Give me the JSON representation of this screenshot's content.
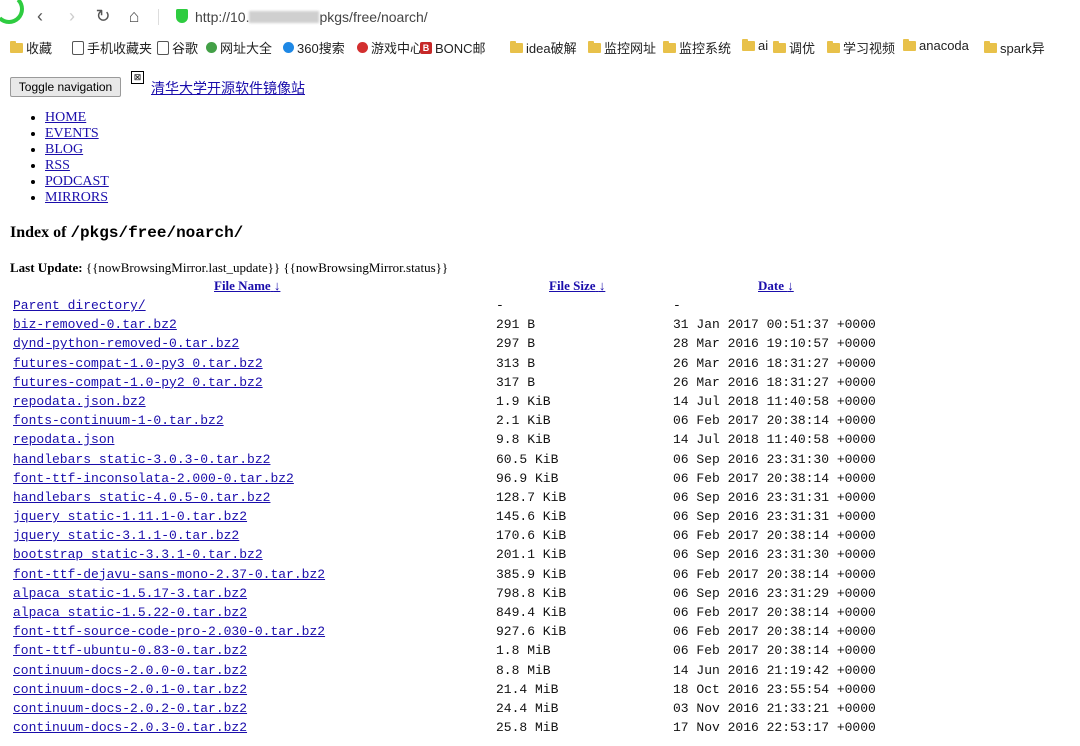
{
  "browser": {
    "url_prefix": "http://10.",
    "url_suffix": "pkgs/free/noarch/",
    "bookmarks": [
      {
        "label": "收藏",
        "icon": "star-icon"
      },
      {
        "label": "手机收藏夹",
        "icon": "phone-icon"
      },
      {
        "label": "谷歌",
        "icon": "page-icon"
      },
      {
        "label": "网址大全",
        "icon": "globe-icon"
      },
      {
        "label": "360搜索",
        "icon": "search-icon"
      },
      {
        "label": "游戏中心",
        "icon": "game-icon"
      },
      {
        "label": "BONC邮",
        "icon": "mail-icon"
      },
      {
        "label": "idea破解",
        "icon": "folder-icon"
      },
      {
        "label": "监控网址",
        "icon": "folder-icon"
      },
      {
        "label": "监控系统",
        "icon": "folder-icon"
      },
      {
        "label": "ai",
        "icon": "folder-icon"
      },
      {
        "label": "调优",
        "icon": "folder-icon"
      },
      {
        "label": "学习视频",
        "icon": "folder-icon"
      },
      {
        "label": "anacoda",
        "icon": "folder-icon"
      },
      {
        "label": "spark异",
        "icon": "folder-icon"
      }
    ]
  },
  "page": {
    "toggle_label": "Toggle navigation",
    "broken_image_glyph": "⊠",
    "site_link": "清华大学开源软件镜像站",
    "menu": [
      "HOME",
      "EVENTS",
      "BLOG",
      "RSS",
      "PODCAST",
      "MIRRORS"
    ],
    "heading_prefix": "Index of ",
    "heading_path": "/pkgs/free/noarch/",
    "last_update_label": "Last Update:",
    "last_update_value": " {{nowBrowsingMirror.last_update}} {{nowBrowsingMirror.status}}"
  },
  "table": {
    "headers": {
      "name": "File Name",
      "size": "File Size",
      "date": "Date",
      "sort_arrow": "↓"
    },
    "rows": [
      {
        "name": "Parent directory/",
        "size": "-",
        "date": "-"
      },
      {
        "name": "biz-removed-0.tar.bz2",
        "size": "291 B",
        "date": "31 Jan 2017 00:51:37 +0000"
      },
      {
        "name": "dynd-python-removed-0.tar.bz2",
        "size": "297 B",
        "date": "28 Mar 2016 19:10:57 +0000"
      },
      {
        "name": "futures-compat-1.0-py3_0.tar.bz2",
        "size": "313 B",
        "date": "26 Mar 2016 18:31:27 +0000"
      },
      {
        "name": "futures-compat-1.0-py2_0.tar.bz2",
        "size": "317 B",
        "date": "26 Mar 2016 18:31:27 +0000"
      },
      {
        "name": "repodata.json.bz2",
        "size": "1.9 KiB",
        "date": "14 Jul 2018 11:40:58 +0000"
      },
      {
        "name": "fonts-continuum-1-0.tar.bz2",
        "size": "2.1 KiB",
        "date": "06 Feb 2017 20:38:14 +0000"
      },
      {
        "name": "repodata.json",
        "size": "9.8 KiB",
        "date": "14 Jul 2018 11:40:58 +0000"
      },
      {
        "name": "handlebars_static-3.0.3-0.tar.bz2",
        "size": "60.5 KiB",
        "date": "06 Sep 2016 23:31:30 +0000"
      },
      {
        "name": "font-ttf-inconsolata-2.000-0.tar.bz2",
        "size": "96.9 KiB",
        "date": "06 Feb 2017 20:38:14 +0000"
      },
      {
        "name": "handlebars_static-4.0.5-0.tar.bz2",
        "size": "128.7 KiB",
        "date": "06 Sep 2016 23:31:31 +0000"
      },
      {
        "name": "jquery_static-1.11.1-0.tar.bz2",
        "size": "145.6 KiB",
        "date": "06 Sep 2016 23:31:31 +0000"
      },
      {
        "name": "jquery_static-3.1.1-0.tar.bz2",
        "size": "170.6 KiB",
        "date": "06 Feb 2017 20:38:14 +0000"
      },
      {
        "name": "bootstrap_static-3.3.1-0.tar.bz2",
        "size": "201.1 KiB",
        "date": "06 Sep 2016 23:31:30 +0000"
      },
      {
        "name": "font-ttf-dejavu-sans-mono-2.37-0.tar.bz2",
        "size": "385.9 KiB",
        "date": "06 Feb 2017 20:38:14 +0000"
      },
      {
        "name": "alpaca_static-1.5.17-3.tar.bz2",
        "size": "798.8 KiB",
        "date": "06 Sep 2016 23:31:29 +0000"
      },
      {
        "name": "alpaca_static-1.5.22-0.tar.bz2",
        "size": "849.4 KiB",
        "date": "06 Feb 2017 20:38:14 +0000"
      },
      {
        "name": "font-ttf-source-code-pro-2.030-0.tar.bz2",
        "size": "927.6 KiB",
        "date": "06 Feb 2017 20:38:14 +0000"
      },
      {
        "name": "font-ttf-ubuntu-0.83-0.tar.bz2",
        "size": "1.8 MiB",
        "date": "06 Feb 2017 20:38:14 +0000"
      },
      {
        "name": "continuum-docs-2.0.0-0.tar.bz2",
        "size": "8.8 MiB",
        "date": "14 Jun 2016 21:19:42 +0000"
      },
      {
        "name": "continuum-docs-2.0.1-0.tar.bz2",
        "size": "21.4 MiB",
        "date": "18 Oct 2016 23:55:54 +0000"
      },
      {
        "name": "continuum-docs-2.0.2-0.tar.bz2",
        "size": "24.4 MiB",
        "date": "03 Nov 2016 21:33:21 +0000"
      },
      {
        "name": "continuum-docs-2.0.3-0.tar.bz2",
        "size": "25.8 MiB",
        "date": "17 Nov 2016 22:53:17 +0000"
      }
    ]
  }
}
